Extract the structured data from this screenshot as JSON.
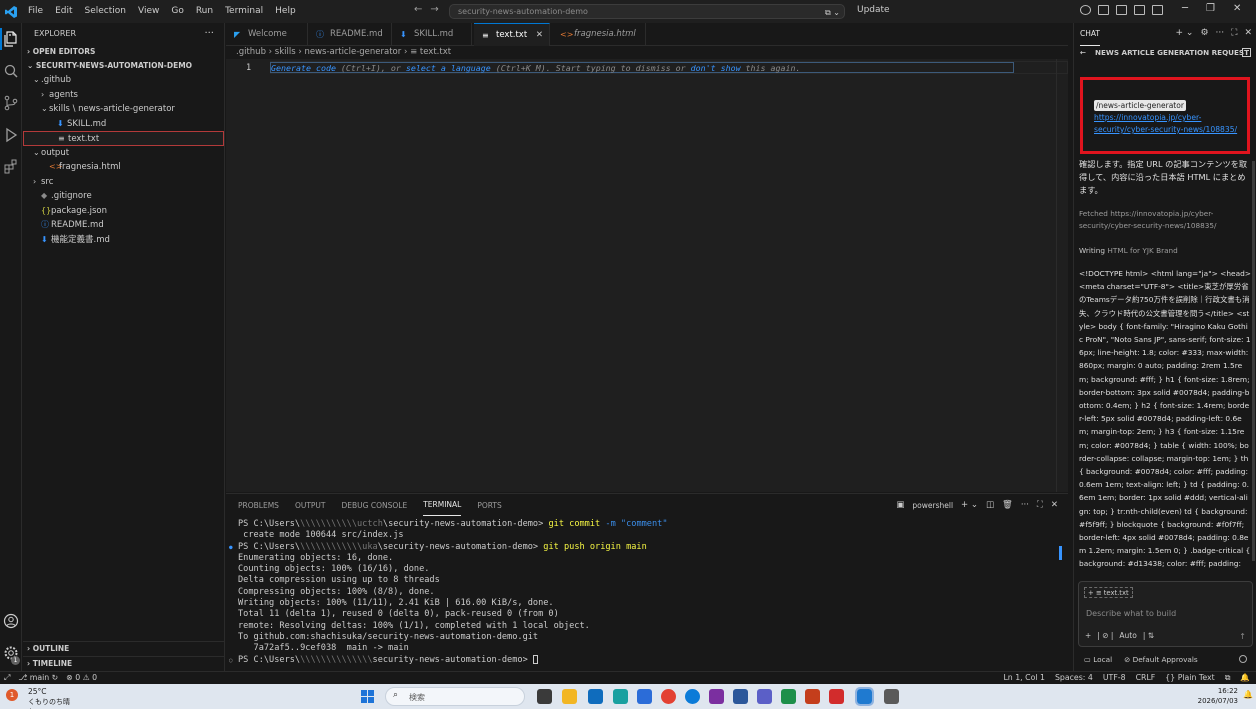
{
  "titlebar": {
    "menu": [
      "File",
      "Edit",
      "Selection",
      "View",
      "Go",
      "Run",
      "Terminal",
      "Help"
    ],
    "search_text": "security-news-automation-demo",
    "update_label": "Update"
  },
  "explorer": {
    "header": "EXPLORER",
    "open_editors": "OPEN EDITORS",
    "project": "SECURITY-NEWS-AUTOMATION-DEMO",
    "tree": [
      {
        "label": ".github",
        "indent": 1,
        "chev": "v",
        "icon": ""
      },
      {
        "label": "agents",
        "indent": 2,
        "chev": ">",
        "icon": ""
      },
      {
        "label": "skills \\ news-article-generator",
        "indent": 2,
        "chev": "v",
        "icon": ""
      },
      {
        "label": "SKILL.md",
        "indent": 3,
        "chev": "",
        "icon": "md"
      },
      {
        "label": "text.txt",
        "indent": 3,
        "chev": "",
        "icon": "txt",
        "selected": true
      },
      {
        "label": "output",
        "indent": 1,
        "chev": "v",
        "icon": ""
      },
      {
        "label": "fragnesia.html",
        "indent": 2,
        "chev": "",
        "icon": "html"
      },
      {
        "label": "src",
        "indent": 1,
        "chev": ">",
        "icon": ""
      },
      {
        "label": ".gitignore",
        "indent": 1,
        "chev": "",
        "icon": "git"
      },
      {
        "label": "package.json",
        "indent": 1,
        "chev": "",
        "icon": "json"
      },
      {
        "label": "README.md",
        "indent": 1,
        "chev": "",
        "icon": "info"
      },
      {
        "label": "機能定義書.md",
        "indent": 1,
        "chev": "",
        "icon": "md"
      }
    ],
    "outline": "OUTLINE",
    "timeline": "TIMELINE"
  },
  "tabs": [
    {
      "label": "Welcome",
      "icon": "vscode"
    },
    {
      "label": "README.md",
      "icon": "info"
    },
    {
      "label": "SKILL.md",
      "icon": "md"
    },
    {
      "label": "text.txt",
      "icon": "txt",
      "active": true
    },
    {
      "label": "fragnesia.html",
      "icon": "html",
      "italic": true
    }
  ],
  "breadcrumb": [
    ".github",
    "skills",
    "news-article-generator",
    "text.txt"
  ],
  "editor": {
    "line_number": "1",
    "hint_parts": [
      {
        "text": "Generate code",
        "link": true
      },
      {
        "text": " (Ctrl+I), or ",
        "link": false
      },
      {
        "text": "select a language",
        "link": true
      },
      {
        "text": " (Ctrl+K M). Start typing to dismiss or ",
        "link": false
      },
      {
        "text": "don't show",
        "link": true
      },
      {
        "text": " this again.",
        "link": false
      }
    ]
  },
  "panel": {
    "tabs": [
      "PROBLEMS",
      "OUTPUT",
      "DEBUG CONSOLE",
      "TERMINAL",
      "PORTS"
    ],
    "active_tab": "TERMINAL",
    "shell": "powershell",
    "lines": [
      {
        "prompt": "PS C:\\Users\\",
        "blur": "\\\\\\\\\\\\\\\\\\\\\\uctch",
        "path": "\\security-news-automation-demo> ",
        "cmd": "git commit ",
        "args": "-m ",
        "str": "\"comment\"",
        "marker": ""
      },
      {
        "text": " create mode 100644 src/index.js",
        "marker": ""
      },
      {
        "prompt": "PS C:\\Users\\",
        "blur": "\\\\\\\\\\\\\\\\\\\\\\\\uka",
        "path": "\\security-news-automation-demo> ",
        "cmd": "git push origin main",
        "args": "",
        "str": "",
        "marker": "dot"
      },
      {
        "text": "Enumerating objects: 16, done.",
        "marker": ""
      },
      {
        "text": "Counting objects: 100% (16/16), done.",
        "marker": ""
      },
      {
        "text": "Delta compression using up to 8 threads",
        "marker": ""
      },
      {
        "text": "Compressing objects: 100% (8/8), done.",
        "marker": ""
      },
      {
        "text": "Writing objects: 100% (11/11), 2.41 KiB | 616.00 KiB/s, done.",
        "marker": ""
      },
      {
        "text": "Total 11 (delta 1), reused 0 (delta 0), pack-reused 0 (from 0)",
        "marker": ""
      },
      {
        "text": "remote: Resolving deltas: 100% (1/1), completed with 1 local object.",
        "marker": ""
      },
      {
        "text": "To github.com:shachisuka/security-news-automation-demo.git",
        "marker": ""
      },
      {
        "text": "   7a72af5..9cef038  main -> main",
        "marker": ""
      },
      {
        "prompt": "PS C:\\Users\\",
        "blur": "\\\\\\\\\\\\\\\\\\\\\\\\\\\\",
        "path": "security-news-automation-demo> ",
        "cmd": "",
        "args": "",
        "str": "",
        "marker": "odot"
      }
    ]
  },
  "chat": {
    "title": "CHAT",
    "subtitle": "NEWS ARTICLE GENERATION REQUEST",
    "command_tag": "/news-article-generator",
    "request_url": "https://innovatopia.jp/cyber-security/cyber-security-news/108835/",
    "reply": "確認します。指定 URL の記事コンテンツを取得して、内容に沿った日本語 HTML にまとめます。",
    "fetched": "Fetched https://innovatopia.jp/cyber-security/cyber-security-news/108835/",
    "writing_prefix": "Writing ",
    "writing_target": "HTML for YJK Brand",
    "code": "<!DOCTYPE html> <html lang=\"ja\"> <head> <meta charset=\"UTF-8\"> <title>東芝が厚労省のTeamsデータ約750万件を誤削除｜行政文書も消失、クラウド時代の公文書管理を問う</title> <style> body { font-family: \"Hiragino Kaku Gothic ProN\", \"Noto Sans JP\", sans-serif; font-size: 16px; line-height: 1.8; color: #333; max-width: 860px; margin: 0 auto; padding: 2rem 1.5rem; background: #fff; } h1 { font-size: 1.8rem; border-bottom: 3px solid #0078d4; padding-bottom: 0.4em; } h2 { font-size: 1.4rem; border-left: 5px solid #0078d4; padding-left: 0.6em; margin-top: 2em; } h3 { font-size: 1.15rem; color: #0078d4; } table { width: 100%; border-collapse: collapse; margin-top: 1em; } th { background: #0078d4; color: #fff; padding: 0.6em 1em; text-align: left; } td { padding: 0.6em 1em; border: 1px solid #ddd; vertical-align: top; } tr:nth-child(even) td { background: #f5f9ff; } blockquote { background: #f0f7ff; border-left: 4px solid #0078d4; padding: 0.8em 1.2em; margin: 1.5em 0; } .badge-critical { background: #d13438; color: #fff; padding:",
    "attachment": "text.txt",
    "input_placeholder": "Describe what to build",
    "mode": "Auto",
    "footer_local": "Local",
    "footer_approvals": "Default Approvals"
  },
  "statusbar": {
    "branch": "main",
    "errors": "0",
    "warnings": "0",
    "position": "Ln 1, Col 1",
    "spaces": "Spaces: 4",
    "encoding": "UTF-8",
    "eol": "CRLF",
    "language": "Plain Text"
  },
  "taskbar": {
    "temp": "25°C",
    "weather": "くもりのち晴れ",
    "search_placeholder": "検索",
    "time": "16:22",
    "date": "2026/07/03"
  },
  "colors": {
    "accent": "#0078d4",
    "highlight_box": "#e0141e",
    "link": "#3794ff"
  }
}
